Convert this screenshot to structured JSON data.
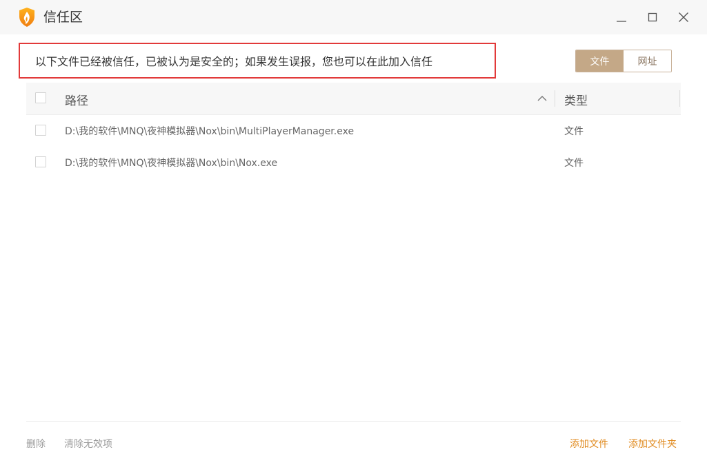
{
  "window": {
    "title": "信任区",
    "controls": [
      "minimize-icon",
      "maximize-icon",
      "close-icon"
    ]
  },
  "notice": {
    "text": "以下文件已经被信任，已被认为是安全的；如果发生误报，您也可以在此加入信任",
    "border_color": "#e23a3a"
  },
  "tabs": [
    {
      "label": "文件",
      "active": true
    },
    {
      "label": "网址",
      "active": false
    }
  ],
  "table": {
    "columns": {
      "path": "路径",
      "type": "类型"
    },
    "sort_icon": "chevron-up-icon",
    "rows": [
      {
        "path": "D:\\我的软件\\MNQ\\夜神模拟器\\Nox\\bin\\MultiPlayerManager.exe",
        "type": "文件"
      },
      {
        "path": "D:\\我的软件\\MNQ\\夜神模拟器\\Nox\\bin\\Nox.exe",
        "type": "文件"
      }
    ]
  },
  "footer": {
    "delete_label": "删除",
    "clear_invalid_label": "清除无效项",
    "add_file_label": "添加文件",
    "add_folder_label": "添加文件夹"
  },
  "colors": {
    "accent": "#c4a887",
    "link_orange": "#e08a1e",
    "titlebar_bg": "#f7f7f7"
  }
}
